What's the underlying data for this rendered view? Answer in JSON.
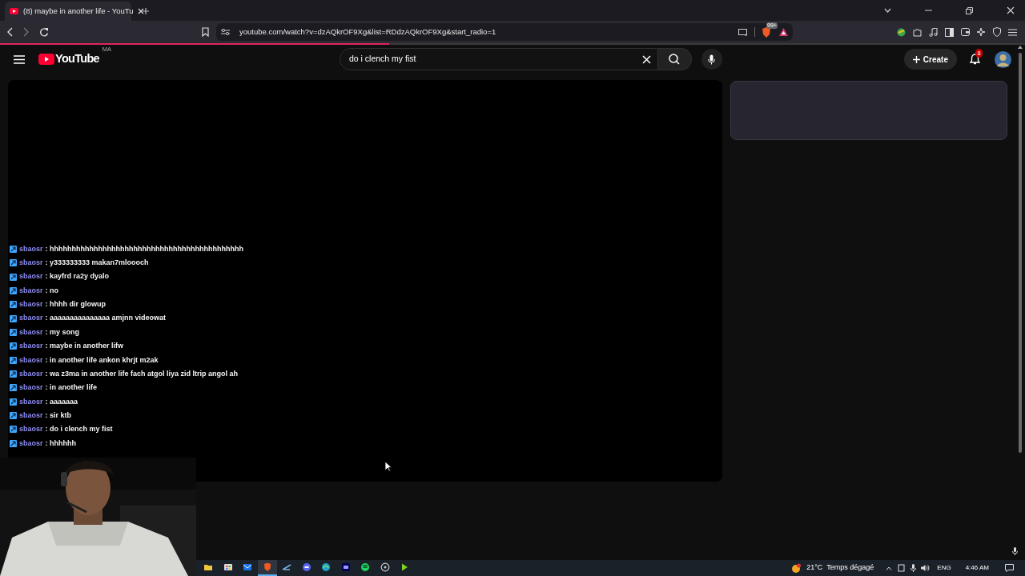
{
  "browser": {
    "tab": {
      "title": "(8) maybe in another life - YouTu",
      "selected": true
    },
    "url": "youtube.com/watch?v=dzAQkrOF9Xg&list=RDdzAQkrOF9Xg&start_radio=1",
    "shield_badge": "99+",
    "load_progress": {
      "level": 0.38
    }
  },
  "youtube": {
    "logo": "YouTube",
    "country": "MA",
    "search": {
      "value": "do i clench my fist"
    },
    "create": "Create",
    "notifications": "8"
  },
  "chat": [
    {
      "user": "sbaosr",
      "text": ": hhhhhhhhhhhhhhhhhhhhhhhhhhhhhhhhhhhhhhhhhhhh"
    },
    {
      "user": "sbaosr",
      "text": ": y333333333 makan7mloooch"
    },
    {
      "user": "sbaosr",
      "text": ": kayfrd ra2y dyalo"
    },
    {
      "user": "sbaosr",
      "text": ": no"
    },
    {
      "user": "sbaosr",
      "text": ": hhhh dir glowup"
    },
    {
      "user": "sbaosr",
      "text": ": aaaaaaaaaaaaaaa amjnn videowat"
    },
    {
      "user": "sbaosr",
      "text": ": my song"
    },
    {
      "user": "sbaosr",
      "text": ": maybe in another lifw"
    },
    {
      "user": "sbaosr",
      "text": ": in another life ankon khrjt m2ak"
    },
    {
      "user": "sbaosr",
      "text": ": wa z3ma in another life fach atgol liya zid ltrip angol ah"
    },
    {
      "user": "sbaosr",
      "text": ": in another life"
    },
    {
      "user": "sbaosr",
      "text": ": aaaaaaa"
    },
    {
      "user": "sbaosr",
      "text": ": sir ktb"
    },
    {
      "user": "sbaosr",
      "text": ": do i clench my fist"
    },
    {
      "user": "sbaosr",
      "text": ": hhhhhh"
    }
  ],
  "taskbar": {
    "apps": [
      {
        "selected": false
      },
      {
        "selected": false
      },
      {
        "selected": false
      },
      {
        "selected": true
      },
      {
        "selected": false
      },
      {
        "selected": false
      },
      {
        "selected": false
      },
      {
        "selected": false
      },
      {
        "selected": false
      },
      {
        "selected": false
      },
      {
        "selected": false
      }
    ],
    "weather": "21°C",
    "weather_text": "Temps dégagé",
    "language": "ENG",
    "time": "4:46 AM"
  }
}
